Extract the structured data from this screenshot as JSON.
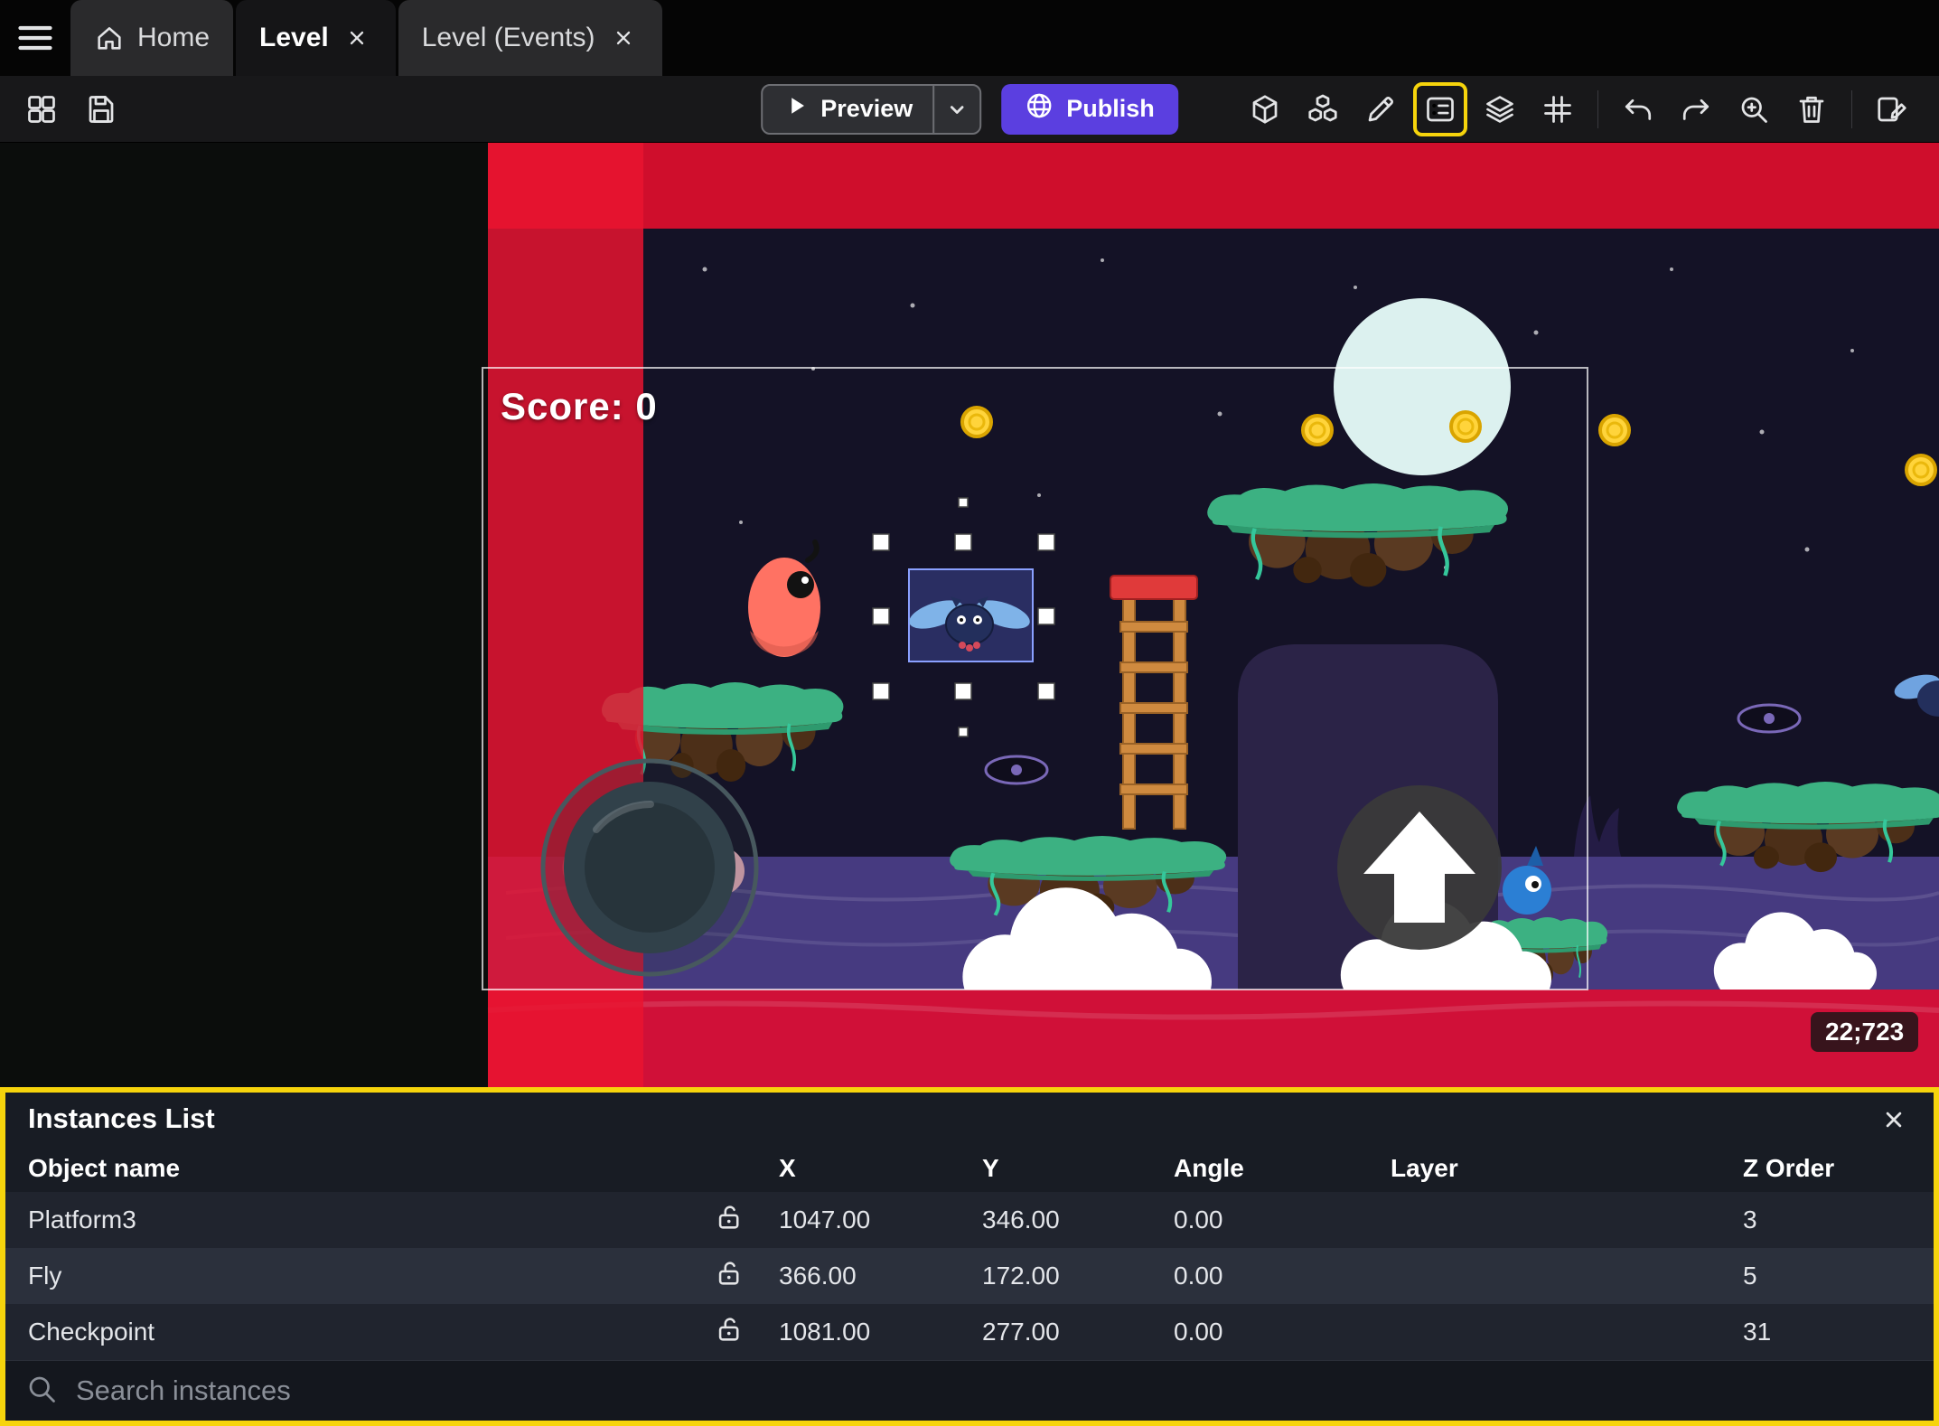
{
  "tabs": {
    "home": "Home",
    "level": "Level",
    "level_events": "Level (Events)"
  },
  "toolbar": {
    "preview_label": "Preview",
    "publish_label": "Publish"
  },
  "scene": {
    "score_text": "Score: 0",
    "coordinates_badge": "22;723"
  },
  "instances_panel": {
    "title": "Instances List",
    "columns": [
      "Object name",
      "X",
      "Y",
      "Angle",
      "Layer",
      "Z Order"
    ],
    "rows": [
      {
        "name": "Platform3",
        "x": "1047.00",
        "y": "346.00",
        "angle": "0.00",
        "layer": "",
        "z_order": "3"
      },
      {
        "name": "Fly",
        "x": "366.00",
        "y": "172.00",
        "angle": "0.00",
        "layer": "",
        "z_order": "5"
      },
      {
        "name": "Checkpoint",
        "x": "1081.00",
        "y": "277.00",
        "angle": "0.00",
        "layer": "",
        "z_order": "31"
      }
    ],
    "search_placeholder": "Search instances"
  },
  "icons": {
    "hamburger-menu": "three-lines",
    "home": "house",
    "close": "x-cross",
    "layout": "dashboard-squares",
    "save": "floppy-disk",
    "play": "triangle-right",
    "caret-down": "chevron-down",
    "globe": "globe-meridians",
    "cube": "3d-box",
    "object-groups": "stacked-cubes",
    "edit": "pencil",
    "instances-list": "list-in-frame",
    "layers": "stacked-layers",
    "grid": "hash-grid",
    "undo": "arrow-curve-left",
    "redo": "arrow-curve-right",
    "zoom-in": "magnifier-plus",
    "trash": "waste-bin",
    "scene-edit": "panel-pencil",
    "lock-open": "open-padlock",
    "search": "magnifier"
  },
  "colors": {
    "accent_purple": "#5b3fe0",
    "highlight_yellow": "#f6d40c",
    "red_band": "#e8112d",
    "panel_bg": "#181c24",
    "row_alt": "#2b303c"
  }
}
